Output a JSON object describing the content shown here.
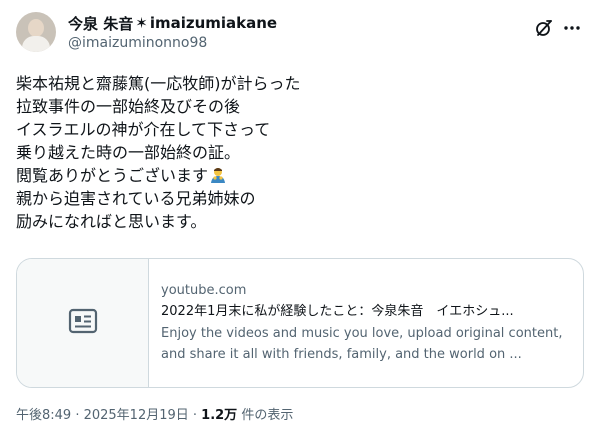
{
  "author": {
    "display_name": "今泉 朱音",
    "name_separator": "✶",
    "name_suffix": "imaizumiakane",
    "handle": "@imaizuminonno98"
  },
  "tweet": {
    "lines": [
      "柴本祐規と齋藤篤(一応牧師)が計らった",
      "拉致事件の一部始終及びその後",
      "イスラエルの神が介在して下さって",
      "乗り越えた時の一部始終の証。",
      "閲覧ありがとうございます",
      "親から迫害されている兄弟姉妹の",
      "励みになればと思います。"
    ],
    "emoji_icon": "person-bowing-emoji"
  },
  "card": {
    "domain": "youtube.com",
    "title": "2022年1月末に私が経験したこと：今泉朱音　イエホシュ...",
    "description": "Enjoy the videos and music you love, upload original content, and share it all with friends, family, and the world on ..."
  },
  "meta": {
    "time_date": "午後8:49 · 2025年12月19日 · ",
    "views_count": "1.2万",
    "views_label": " 件の表示"
  },
  "colors": {
    "text": "#0f1419",
    "secondary": "#536471",
    "border": "#cfd9de"
  }
}
